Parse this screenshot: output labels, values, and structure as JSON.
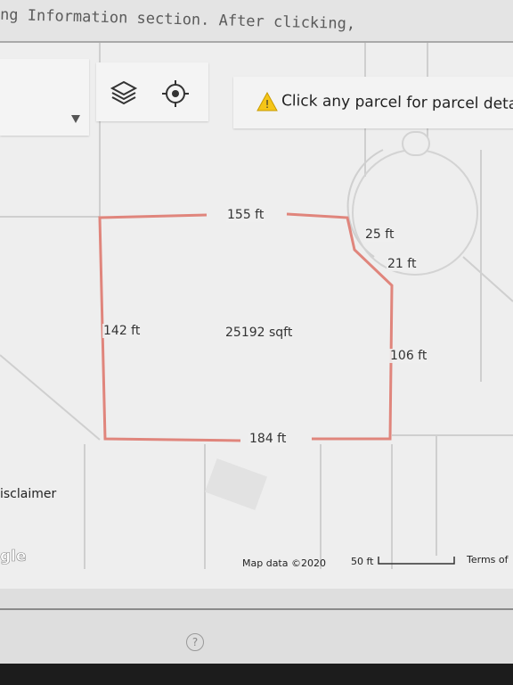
{
  "intro": {
    "text": "ng Information section.  After clicking,"
  },
  "toolbar": {
    "dropdown_icon": "chevron-down-icon",
    "layers_icon": "layers-icon",
    "locate_icon": "locate-icon"
  },
  "notice": {
    "text": "Click any parcel for parcel deta",
    "icon": "warning-icon"
  },
  "parcel": {
    "top_edge": "155 ft",
    "top_right_edge": "25 ft",
    "right_upper_edge": "21 ft",
    "left_edge": "142 ft",
    "area": "25192 sqft",
    "right_edge": "106 ft",
    "bottom_edge": "184 ft",
    "outline_color": "#e0857c"
  },
  "map_footer": {
    "disclaimer": "isclaimer",
    "google": "gle",
    "map_data": "Map data ©2020",
    "scale": "50 ft",
    "terms": "Terms of"
  },
  "colors": {
    "background": "#eeeeee",
    "road": "#cfcfcf",
    "taskbar": "#1c1c1c"
  }
}
